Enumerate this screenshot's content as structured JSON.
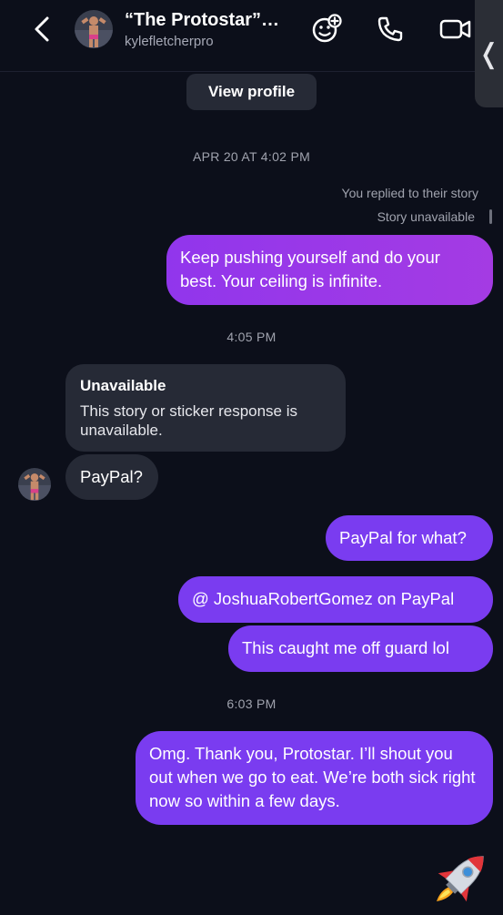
{
  "header": {
    "title": "“The Protostar”…",
    "username": "kylefletcherpro",
    "icons": [
      "back-chevron-icon",
      "sticker-add-icon",
      "phone-icon",
      "video-camera-icon"
    ]
  },
  "side_tab": {
    "glyph": "❬"
  },
  "profile": {
    "view_label": "View profile"
  },
  "timestamps": {
    "t1": "APR 20 AT 4:02 PM",
    "t2": "4:05 PM",
    "t3": "6:03 PM"
  },
  "story_reply": {
    "note": "You replied to their story",
    "status": "Story unavailable"
  },
  "messages": {
    "m1": "Keep pushing yourself and do your best. Your ceiling is infinite.",
    "unavailable_title": "Unavailable",
    "unavailable_body": "This story or sticker response is unavailable.",
    "m2": "PayPal?",
    "m3": "PayPal for what?",
    "m4": "@ JoshuaRobertGomez on PayPal",
    "m5": "This caught me off guard lol",
    "m6": "Omg. Thank you, Protostar. I’ll shout you out when we go to eat. We’re both sick right now so within a few days."
  },
  "colors": {
    "background": "#0c0f1a",
    "outgoing_bubble": "#7a3cf0",
    "outgoing_gradient_start": "#9136ec",
    "incoming_bubble": "#262a36",
    "muted_text": "#a0a3ae"
  }
}
